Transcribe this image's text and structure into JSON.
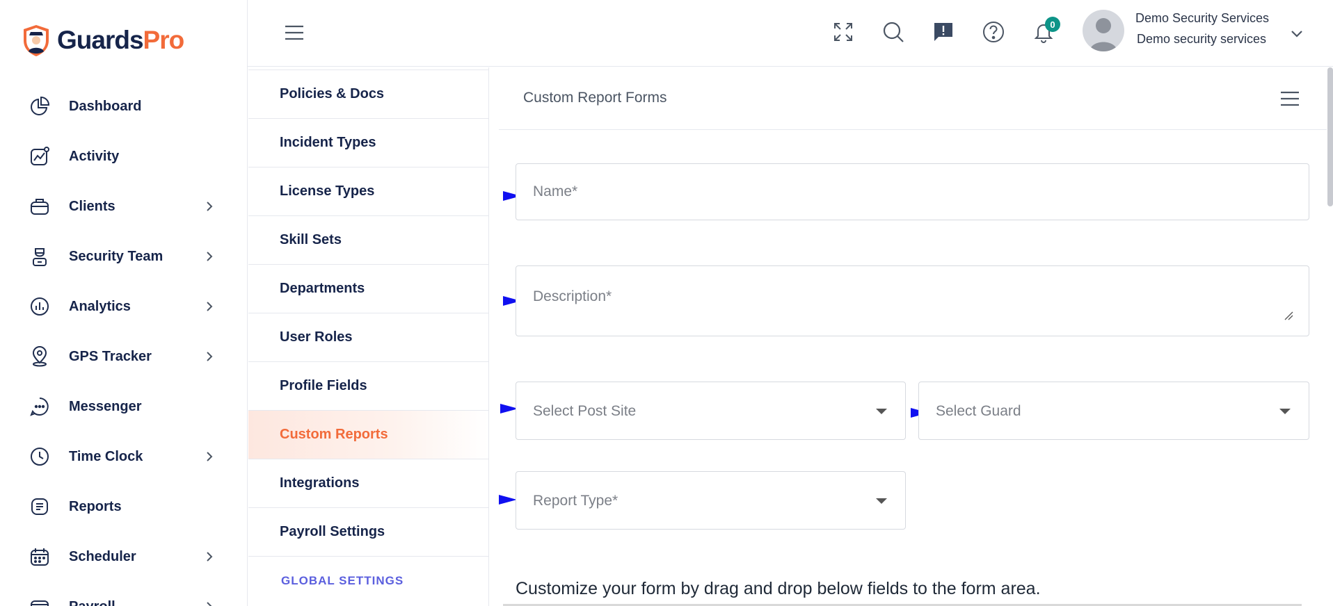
{
  "brand": {
    "part1": "Guards",
    "part2": "Pro",
    "colors": {
      "navy": "#16244a",
      "orange": "#f26b3a"
    }
  },
  "sidebar": {
    "items": [
      {
        "label": "Dashboard",
        "icon": "pie-chart-icon",
        "has_submenu": false
      },
      {
        "label": "Activity",
        "icon": "activity-icon",
        "has_submenu": false
      },
      {
        "label": "Clients",
        "icon": "briefcase-icon",
        "has_submenu": true
      },
      {
        "label": "Security Team",
        "icon": "guard-icon",
        "has_submenu": true
      },
      {
        "label": "Analytics",
        "icon": "bar-chart-icon",
        "has_submenu": true
      },
      {
        "label": "GPS Tracker",
        "icon": "location-pin-icon",
        "has_submenu": true
      },
      {
        "label": "Messenger",
        "icon": "chat-icon",
        "has_submenu": false
      },
      {
        "label": "Time Clock",
        "icon": "clock-icon",
        "has_submenu": true
      },
      {
        "label": "Reports",
        "icon": "document-icon",
        "has_submenu": false
      },
      {
        "label": "Scheduler",
        "icon": "calendar-icon",
        "has_submenu": true
      },
      {
        "label": "Payroll",
        "icon": "wallet-icon",
        "has_submenu": true
      }
    ]
  },
  "topbar": {
    "notification_count": "0",
    "user_name": "Demo Security Services",
    "user_org": "Demo security services"
  },
  "settings_menu": {
    "items": [
      {
        "label": "Policies & Docs",
        "active": false
      },
      {
        "label": "Incident Types",
        "active": false
      },
      {
        "label": "License Types",
        "active": false
      },
      {
        "label": "Skill Sets",
        "active": false
      },
      {
        "label": "Departments",
        "active": false
      },
      {
        "label": "User Roles",
        "active": false
      },
      {
        "label": "Profile Fields",
        "active": false
      },
      {
        "label": "Custom Reports",
        "active": true
      },
      {
        "label": "Integrations",
        "active": false
      },
      {
        "label": "Payroll Settings",
        "active": false
      }
    ],
    "section_label": "GLOBAL SETTINGS"
  },
  "form": {
    "title": "Custom Report Forms",
    "name_placeholder": "Name*",
    "description_placeholder": "Description*",
    "post_site_placeholder": "Select Post Site",
    "guard_placeholder": "Select Guard",
    "report_type_placeholder": "Report Type*",
    "help_text": "Customize your form by drag and drop below fields to the form area."
  }
}
